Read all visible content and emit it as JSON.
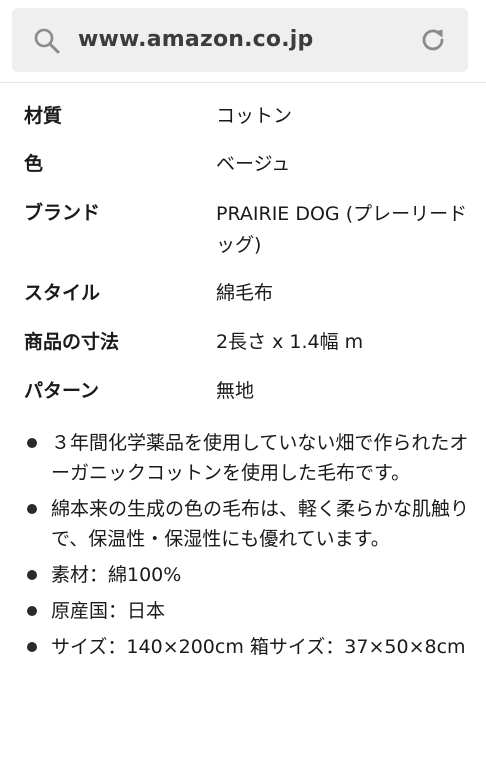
{
  "browser": {
    "url": "www.amazon.co.jp",
    "search_icon": "search-icon",
    "reload_icon": "reload-icon"
  },
  "specs": [
    {
      "key": "材質",
      "value": "コットン"
    },
    {
      "key": "色",
      "value": "ベージュ"
    },
    {
      "key": "ブランド",
      "value": "PRAIRIE DOG (プレーリードッグ)"
    },
    {
      "key": "スタイル",
      "value": "綿毛布"
    },
    {
      "key": "商品の寸法",
      "value": "2長さ x 1.4幅 m"
    },
    {
      "key": "パターン",
      "value": "無地"
    }
  ],
  "bullets": [
    "３年間化学薬品を使用していない畑で作られたオーガニックコットンを使用した毛布です。",
    "綿本来の生成の色の毛布は、軽く柔らかな肌触りで、保温性・保湿性にも優れています。",
    "素材：綿100%",
    "原産国：日本",
    "サイズ：140×200cm 箱サイズ：37×50×8cm"
  ]
}
